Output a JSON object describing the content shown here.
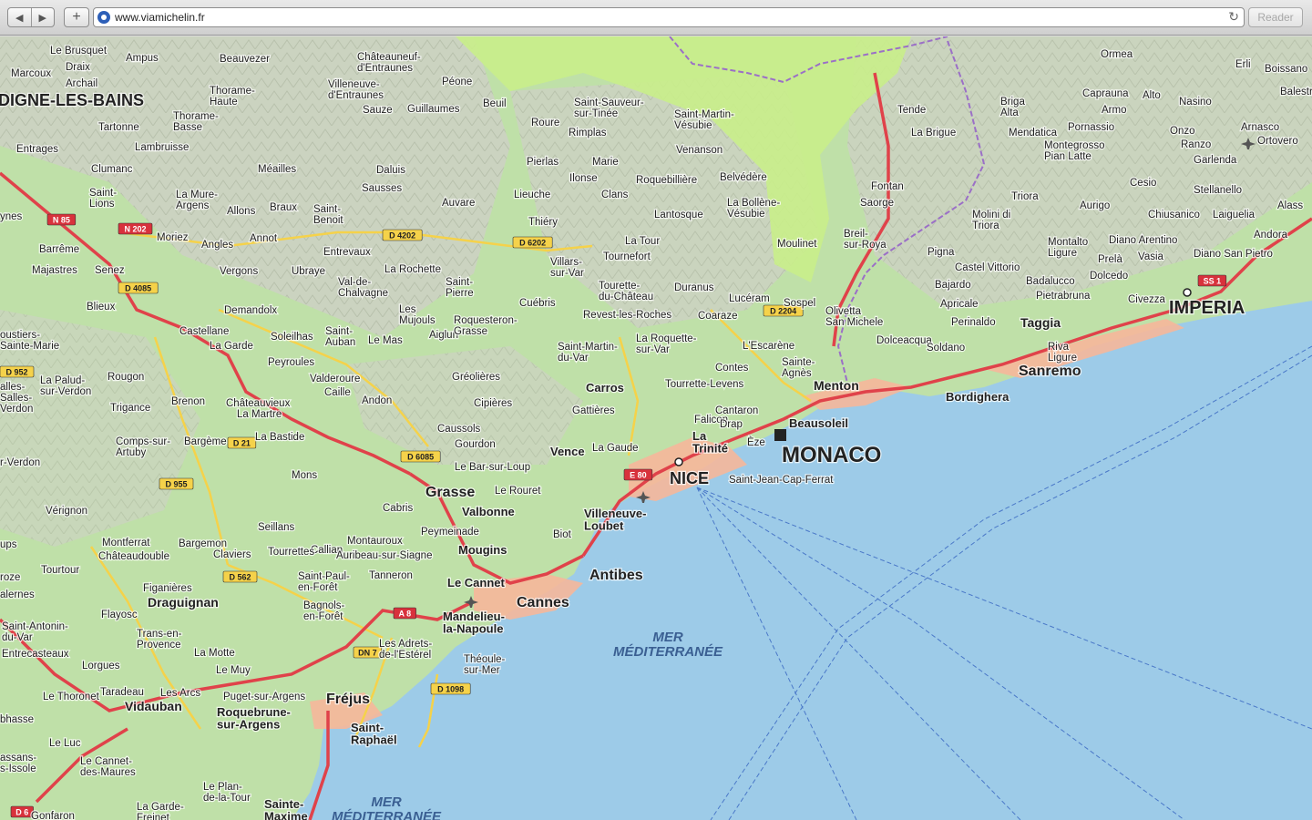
{
  "browser": {
    "url": "www.viamichelin.fr",
    "reader_label": "Reader",
    "back_icon": "back-arrow-icon",
    "forward_icon": "forward-arrow-icon",
    "reload_icon": "reload-icon"
  },
  "colors": {
    "sea": "#9dcbe8",
    "land": "#bfe0a8",
    "mountain": "#d4d4cc",
    "urban": "#f6b79a",
    "motorway": "#e0424a",
    "main_road": "#f5d24a",
    "border": "#9b6fc7",
    "park": "#c9ee8a"
  },
  "places": {
    "digne": "DIGNE-LES-BAINS",
    "nice": "NICE",
    "monaco": "MONACO",
    "imperia": "IMPERIA",
    "sanremo": "Sanremo",
    "bordighera": "Bordighera",
    "taggia": "Taggia",
    "menton": "Menton",
    "beausoleil": "Beausoleil",
    "antibes": "Antibes",
    "cannes": "Cannes",
    "grasse": "Grasse",
    "frejus": "Fréjus",
    "draguignan": "Draguignan",
    "vidauban": "Vidauban",
    "le_cannet": "Le Cannet",
    "mougins": "Mougins",
    "valbonne": "Valbonne",
    "vence": "Vence",
    "carros": "Carros",
    "saint_raphael": "Saint-\nRaphaël",
    "mandelieu": "Mandelieu-\nla-Napoule",
    "villeneuve": "Villeneuve-\nLoubet",
    "roquebrune": "Roquebrune-\nsur-Argens",
    "la_trinite": "La\nTrinité",
    "saint_jean": "Saint-Jean-Cap-Ferrat",
    "sainte_maxime": "Sainte-\nMaxime",
    "sea_label_1": "MER\nMÉDITERRANÉE",
    "sea_label_2": "MER\nMÉDITERRANÉE"
  },
  "small_places": [
    "Le Brusquet",
    "Marcoux",
    "Draix",
    "Archail",
    "Beauvezer",
    "Châteauneuf-\nd'Entraunes",
    "Villeneuve-\nd'Entraunes",
    "Péone",
    "Saint-Sauveur-\nsur-Tinée",
    "Saint-Martin-\nVésubie",
    "Ormea",
    "Erli",
    "Boissano",
    "Thorame-\nHaute",
    "Thorame-\nBasse",
    "Tartonne",
    "Entrages",
    "Lambruisse",
    "Sauze",
    "Guillaumes",
    "Beuil",
    "Roure",
    "Rimplas",
    "Venanson",
    "Tende",
    "La Brigue",
    "Briga\nAlta",
    "Mendatica",
    "Caprauna",
    "Alto",
    "Nasino",
    "Armo",
    "Pornassio",
    "Montegrosso\nPian Latte",
    "Onzo",
    "Ranzo",
    "Garlenda",
    "Arnasco",
    "Ortovero",
    "Balestrino",
    "Clumanc",
    "Méailles",
    "Daluis",
    "Sausses",
    "Pierlas",
    "Marie",
    "Ilonse",
    "Roquebillière",
    "Belvédère",
    "Fontan",
    "Saorge",
    "Cesio",
    "Stellanello",
    "Laiguelia",
    "Alass",
    "Saint-\nLions",
    "La Mure-\nArgens",
    "Allons",
    "Braux",
    "Saint-\nBenoit",
    "Auvare",
    "Lieuche",
    "Clans",
    "Thiéry",
    "Lantosque",
    "La Bollène-\nVésubie",
    "Triora",
    "Molini di\nTriora",
    "Aurigo",
    "Chiusanico",
    "Barrême",
    "Moriez",
    "Angles",
    "Annot",
    "Entrevaux",
    "La Tour",
    "Tournefort",
    "Moulinet",
    "Breil-\nsur-Roya",
    "Pigna",
    "Montalto\nLigure",
    "Prelà",
    "Diano Arentino",
    "Vasia",
    "Diano San Pietro",
    "Andora",
    "Majastres",
    "Senez",
    "Vergons",
    "Ubraye",
    "Val-de-\nChalvagne",
    "La Rochette",
    "Saint-\nPierre",
    "Villars-\nsur-Var",
    "Tourette-\ndu-Château",
    "Duranus",
    "Lucéram",
    "Sospel",
    "Castel Vittorio",
    "Bajardo",
    "Badalucco",
    "Dolcedo",
    "Blieux",
    "Demandolx",
    "Cuébris",
    "Les\nMujouls",
    "Aiglun",
    "Roquesteron-\nGrasse",
    "Revest-les-Roches",
    "Coaraze",
    "Olivetta\nSan Michele",
    "Apricale",
    "Perinaldo",
    "Pietrabruna",
    "Civezza",
    "Dolceacqua",
    "Soldano",
    "Castellane",
    "La Garde",
    "Soleilhas",
    "Saint-\nAuban",
    "Le Mas",
    "Saint-Martin-\ndu-Var",
    "La Roquette-\nsur-Var",
    "L'Escarène",
    "Contes",
    "Sainte-\nAgnès",
    "Riva\nLigure",
    "Rougon",
    "Peyroules",
    "Valderoure",
    "Gréolières",
    "La Palud-\nsur-Verdon",
    "Caille",
    "Andon",
    "Cipières",
    "Tourrette-Levens",
    "Trigance",
    "Brenon",
    "Châteauvieux",
    "La Martre",
    "Gattières",
    "Cantaron",
    "Falicon",
    "Drap",
    "Èze",
    "Bargème",
    "La Bastide",
    "Caussols",
    "Gourdon",
    "Comps-sur-\nArtuby",
    "Le Bar-sur-Loup",
    "La Gaude",
    "Mons",
    "Le Rouret",
    "Cabris",
    "Vérignon",
    "Seillans",
    "Peymeinade",
    "Biot",
    "Bargemon",
    "Montferrat",
    "Châteaudouble",
    "Claviers",
    "Montauroux",
    "Callian",
    "Auribeau-sur-Siagne",
    "Tourrettes",
    "Tourtour",
    "Tanneron",
    "Figanières",
    "Saint-Paul-\nen-Forêt",
    "Bagnols-\nen-Forêt",
    "Flayosc",
    "Saint-Antonin-\ndu-Var",
    "Trans-en-\nProvence",
    "Entrecasteaux",
    "La Motte",
    "Lorgues",
    "Le Muy",
    "Les Adrets-\nde-l'Estérel",
    "Théoule-\nsur-Mer",
    "Taradeau",
    "Les Arcs",
    "Puget-sur-Argens",
    "Le Thoronet",
    "Le Luc",
    "Le Cannet-\ndes-Maures",
    "Le Plan-\nde-la-Tour",
    "La Garde-\nFreinet",
    "Gonfaron",
    "Ampus"
  ],
  "edge_places": [
    "ynes",
    "oustiers-\nSainte-Marie",
    "alles-\nSalles-\nVerdon",
    "r-Verdon",
    "ups",
    "roze",
    "alernes",
    "bhasse",
    "assans-\ns-Issole"
  ],
  "road_shields": [
    "N 85",
    "N 202",
    "D 4085",
    "D 4202",
    "D 6202",
    "D 2204",
    "D 21",
    "D 955",
    "D 6085",
    "E 80",
    "D 562",
    "A 8",
    "DN 7",
    "D 1098",
    "SS 1",
    "D 952",
    "D 6"
  ],
  "icons": [
    "airport-icon",
    "city-square-icon",
    "capital-dot-icon"
  ]
}
